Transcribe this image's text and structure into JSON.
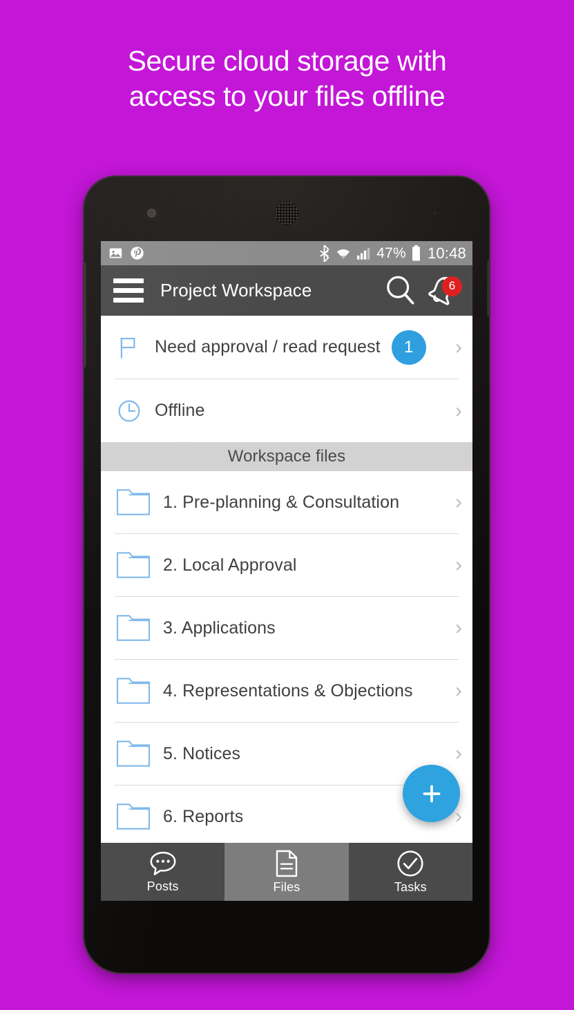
{
  "promo": {
    "headline_line1": "Secure cloud storage with",
    "headline_line2": "access to your files offline",
    "background_color": "#c316d7",
    "text_color": "#ffffff"
  },
  "status_bar": {
    "left_icons": [
      "image-icon",
      "pinterest-icon"
    ],
    "right_icons": [
      "bluetooth-icon",
      "wifi-icon",
      "signal-icon",
      "battery-icon"
    ],
    "battery_percent": "47%",
    "clock": "10:48",
    "background_color": "#8c8c8c"
  },
  "app_bar": {
    "menu_icon": "hamburger-icon",
    "title": "Project Workspace",
    "search_icon": "search-icon",
    "notifications_icon": "bell-icon",
    "notifications_count": "6",
    "badge_color": "#e02020",
    "background_color": "#4a4a4a"
  },
  "top_items": [
    {
      "icon": "flag-icon",
      "label": "Need approval / read request",
      "badge": "1",
      "badge_color": "#2f9fe0",
      "chevron": "›"
    },
    {
      "icon": "clock-icon",
      "label": "Offline",
      "badge": null,
      "chevron": "›"
    }
  ],
  "section": {
    "header": "Workspace files",
    "header_background": "#d2d2d2"
  },
  "folders": [
    {
      "icon": "folder-icon",
      "label": "1. Pre-planning & Consultation",
      "chevron": "›"
    },
    {
      "icon": "folder-icon",
      "label": "2. Local Approval",
      "chevron": "›"
    },
    {
      "icon": "folder-icon",
      "label": "3. Applications",
      "chevron": "›"
    },
    {
      "icon": "folder-icon",
      "label": "4. Representations & Objections",
      "chevron": "›"
    },
    {
      "icon": "folder-icon",
      "label": "5. Notices",
      "chevron": "›"
    },
    {
      "icon": "folder-icon",
      "label": "6. Reports",
      "chevron": "›"
    }
  ],
  "fab": {
    "icon": "plus-icon",
    "label": "+",
    "color": "#2fa2e0"
  },
  "tab_bar": {
    "background_color": "#4a4a4a",
    "active_background_color": "#7d7d7d",
    "tabs": [
      {
        "icon": "chat-bubble-icon",
        "label": "Posts",
        "active": false
      },
      {
        "icon": "document-icon",
        "label": "Files",
        "active": true
      },
      {
        "icon": "check-circle-icon",
        "label": "Tasks",
        "active": false
      }
    ]
  },
  "device": {
    "camera": "front-camera",
    "speaker": "earpiece-speaker",
    "volume_button": "volume-rocker",
    "power_button": "power-button"
  }
}
